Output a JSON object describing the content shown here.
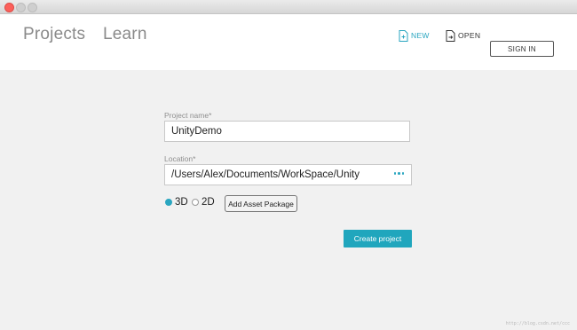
{
  "window": {
    "title": ""
  },
  "header": {
    "tabs": [
      {
        "label": "Projects"
      },
      {
        "label": "Learn"
      }
    ],
    "actions": {
      "new_label": "NEW",
      "new_icon": "new-project-icon",
      "open_label": "OPEN",
      "open_icon": "open-project-icon",
      "signin_label": "SIGN IN"
    }
  },
  "form": {
    "project_name_label": "Project name*",
    "project_name_value": "UnityDemo",
    "location_label": "Location*",
    "location_value": "/Users/Alex/Documents/WorkSpace/Unity",
    "browse_icon": "more-dots-icon",
    "mode_options": [
      {
        "label": "3D",
        "selected": true
      },
      {
        "label": "2D",
        "selected": false
      }
    ],
    "add_asset_label": "Add Asset Package",
    "create_label": "Create project"
  },
  "colors": {
    "accent": "#20a6bd",
    "background": "#f1f1f1",
    "header_bg": "#ffffff"
  },
  "watermark": "http://blog.csdn.net/ccc"
}
